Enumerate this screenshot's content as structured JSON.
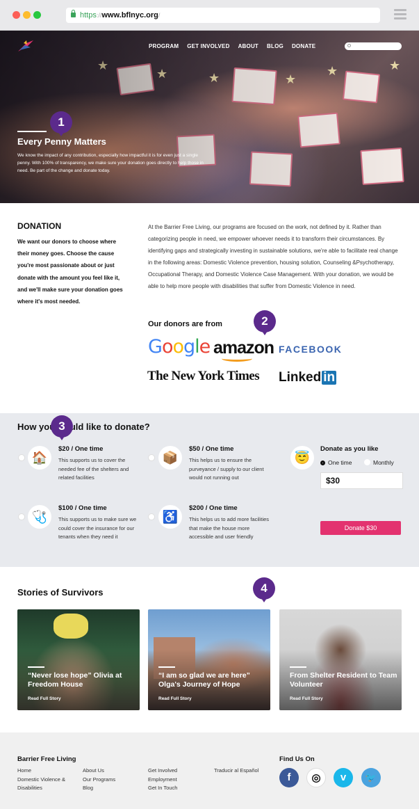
{
  "browser": {
    "url_protocol": "https",
    "url_sep": "://",
    "url_domain": "www.bflnyc.org",
    "url_trail": "/"
  },
  "nav": {
    "items": [
      "PROGRAM",
      "GET INVOLVED",
      "ABOUT",
      "BLOG",
      "DONATE"
    ]
  },
  "hero": {
    "title": "Every Penny Matters",
    "text": "We know the impact of any contribution, especially how impactful it is for even just a single penny. With 100% of transparency, we make sure your donation goes directly to help those in need. Be part of the change and donate today."
  },
  "badges": [
    "1",
    "2",
    "3",
    "4"
  ],
  "donation": {
    "heading": "DONATION",
    "left_text": "We want our donors to choose where their money goes. Choose the cause you're most passionate about or just donate with the amount you feel like it, and we'll make sure your donation goes where it's most needed.",
    "right_text": "At the Barrier Free Living, our programs are focused on the work, not defined by it. Rather than categorizing people in need, we empower whoever needs it to transform their circumstances. By identifying gaps and strategically investing in sustainable solutions, we're able to facilitate real change in the following areas: Domestic Violence prevention, housing solution, Counseling &Psychotherapy, Occupational Therapy, and Domestic Violence Case Management. With your donation, we would be able to help more people with disabilities that suffer from Domestic Violence in need."
  },
  "donors": {
    "heading": "Our donors are from",
    "logos": {
      "google": [
        "G",
        "o",
        "o",
        "g",
        "l",
        "e"
      ],
      "amazon": "amazon",
      "facebook": "FACEBOOK",
      "nyt": "The New York Times",
      "linkedin_a": "Linked",
      "linkedin_b": "in"
    },
    "google_colors": [
      "#4285F4",
      "#EA4335",
      "#FBBC05",
      "#4285F4",
      "#34A853",
      "#EA4335"
    ]
  },
  "donate": {
    "heading": "How you would like to donate?",
    "options": [
      {
        "icon": "house-icon",
        "glyph": "🏠",
        "title": "$20 / One time",
        "desc": "This supports us to cover the needed fee of the shelters and related facilities"
      },
      {
        "icon": "box-icon",
        "glyph": "📦",
        "title": "$50 / One time",
        "desc": "This helps us to ensure the purveyance / supply to our client would not running out"
      },
      {
        "icon": "stethoscope-icon",
        "glyph": "🩺",
        "title": "$100 / One time",
        "desc": "This supports us to make sure we could cover the insurance for our tenants when they need it"
      },
      {
        "icon": "wheelchair-icon",
        "glyph": "♿",
        "title": "$200 / One time",
        "desc": "This helps us to add more facilities that make the house more accessible and user friendly"
      }
    ],
    "custom": {
      "icon": "angel-face-icon",
      "glyph": "😇",
      "title": "Donate as you like",
      "one_time": "One time",
      "monthly": "Monthly",
      "amount": "$30",
      "button": "Donate $30"
    }
  },
  "stories": {
    "heading": "Stories of Survivors",
    "read_label": "Read Full Story",
    "items": [
      {
        "title": "“Never lose hope” Olivia at Freedom House"
      },
      {
        "title": "“I am so glad we are here” Olga's Journey of Hope"
      },
      {
        "title": "From Shelter Resident to Team Volunteer"
      }
    ]
  },
  "footer": {
    "org": "Barrier Free Living",
    "col1": [
      "Home",
      "Domestic Violence &",
      "Disabilities"
    ],
    "col2": [
      "About Us",
      "Our Programs",
      "Blog"
    ],
    "col3": [
      "Get Involved",
      "Employment",
      "Get In Touch"
    ],
    "col4": [
      "Traducir al Español"
    ],
    "find_us": "Find Us On",
    "social": [
      {
        "name": "facebook-icon",
        "glyph": "f",
        "color": "#3b5998"
      },
      {
        "name": "instagram-icon",
        "glyph": "◎",
        "color": "#ffffff"
      },
      {
        "name": "vimeo-icon",
        "glyph": "v",
        "color": "#1ab7ea"
      },
      {
        "name": "twitter-icon",
        "glyph": "🐦",
        "color": "#4aa3df"
      }
    ]
  },
  "colors": {
    "accent_purple": "#5b2a8c",
    "donate_pink": "#e3326f"
  }
}
